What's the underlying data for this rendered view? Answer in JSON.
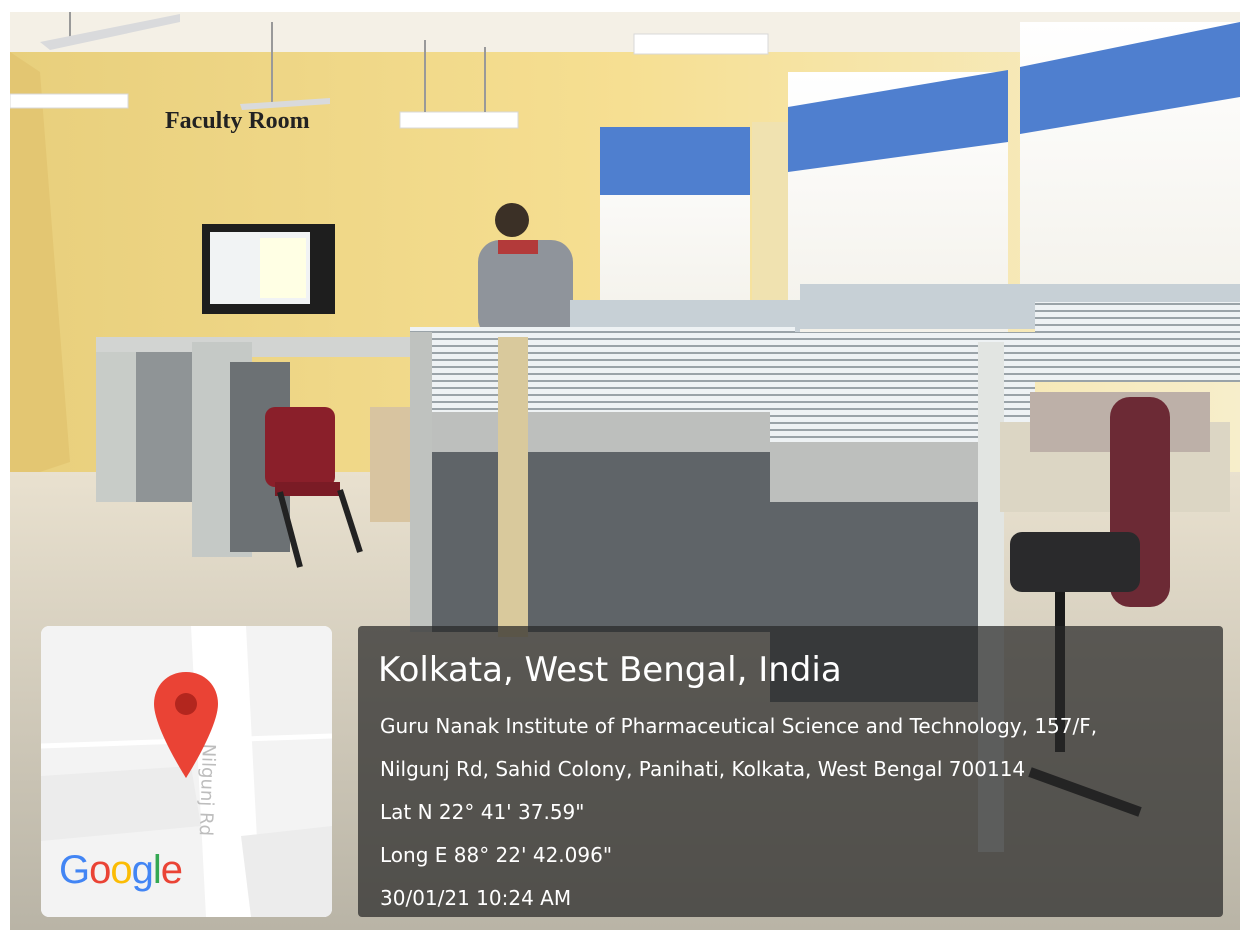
{
  "photo": {
    "caption": "Faculty Room"
  },
  "map": {
    "road_label": "Nilgunj Rd",
    "pin_icon": "map-pin-icon",
    "logo_letters": [
      {
        "ch": "G",
        "color": "#4285F4"
      },
      {
        "ch": "o",
        "color": "#EA4335"
      },
      {
        "ch": "o",
        "color": "#FBBC05"
      },
      {
        "ch": "g",
        "color": "#4285F4"
      },
      {
        "ch": "l",
        "color": "#34A853"
      },
      {
        "ch": "e",
        "color": "#EA4335"
      }
    ],
    "pin_color": "#EA4335"
  },
  "location": {
    "title": "Kolkata, West Bengal, India",
    "address_line1": "Guru Nanak Institute of Pharmaceutical Science and Technology, 157/F,",
    "address_line2": "Nilgunj Rd, Sahid Colony, Panihati, Kolkata, West Bengal 700114",
    "latitude": "Lat N 22° 41' 37.59\"",
    "longitude": "Long E 88° 22' 42.096\"",
    "timestamp": "30/01/21 10:24 AM"
  }
}
